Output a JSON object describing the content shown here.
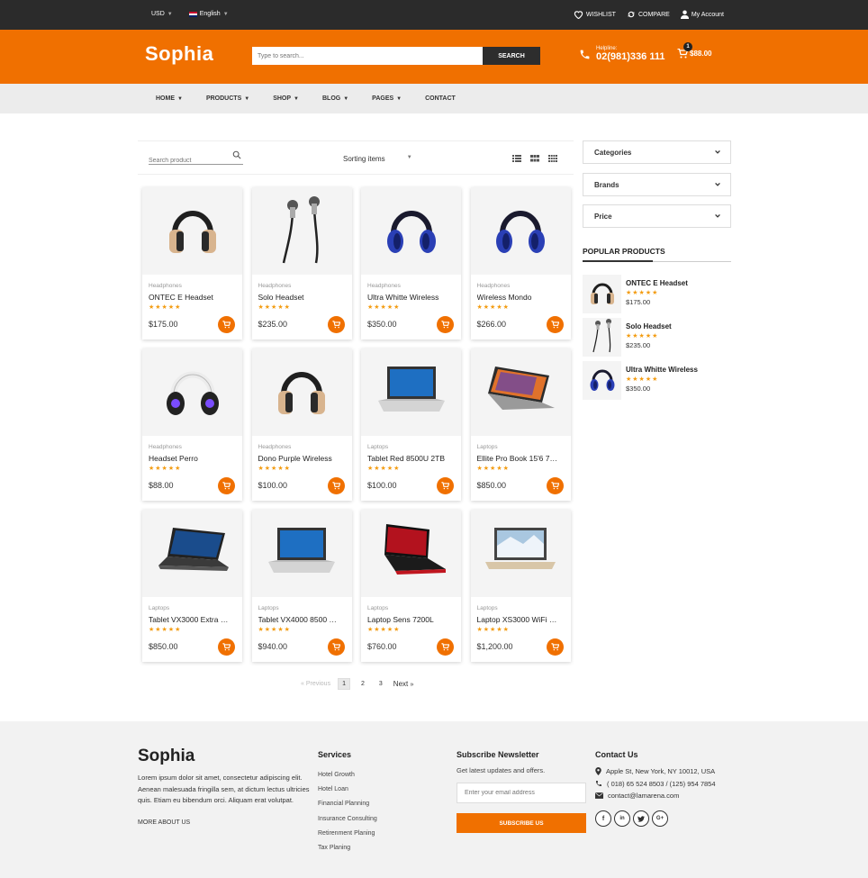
{
  "topbar": {
    "currency": "USD",
    "language": "English",
    "wishlist": "WISHLIST",
    "compare": "COMPARE",
    "account": "My Account"
  },
  "header": {
    "logo": "Sophia",
    "search_placeholder": "Type to search...",
    "search_button": "SEARCH",
    "helpline_label": "Helpline:",
    "helpline_number": "02(981)336 111",
    "cart_count": "1",
    "cart_total": "$88.00",
    "accent_color": "#f07000"
  },
  "nav": {
    "items": [
      "HOME",
      "PRODUCTS",
      "SHOP",
      "BLOG",
      "PAGES",
      "CONTACT"
    ]
  },
  "toolbar": {
    "search_placeholder": "Search product",
    "sorting": "Sorting items"
  },
  "products": [
    {
      "category": "Headphones",
      "name": "ONTEC E Headset",
      "price": "$175.00",
      "image": "headphone-beige-icon",
      "rating": 5
    },
    {
      "category": "Headphones",
      "name": "Solo Headset",
      "price": "$235.00",
      "image": "earphones-icon",
      "rating": 5
    },
    {
      "category": "Headphones",
      "name": "Ultra Whitte Wireless",
      "price": "$350.00",
      "image": "headphone-blue-icon",
      "rating": 5
    },
    {
      "category": "Headphones",
      "name": "Wireless Mondo",
      "price": "$266.00",
      "image": "headphone-blue-icon",
      "rating": 5
    },
    {
      "category": "Headphones",
      "name": "Headset Perro",
      "price": "$88.00",
      "image": "headphone-white-icon",
      "rating": 5
    },
    {
      "category": "Headphones",
      "name": "Dono Purple Wireless",
      "price": "$100.00",
      "image": "headphone-beige-icon",
      "rating": 5
    },
    {
      "category": "Laptops",
      "name": "Tablet Red 8500U 2TB",
      "price": "$100.00",
      "image": "laptop-silver-icon",
      "rating": 5
    },
    {
      "category": "Laptops",
      "name": "Ellite Pro Book 15'6 7…",
      "price": "$850.00",
      "image": "laptop-convertible-icon",
      "rating": 5
    },
    {
      "category": "Laptops",
      "name": "Tablet VX3000 Extra …",
      "price": "$850.00",
      "image": "laptop-dark-icon",
      "rating": 5
    },
    {
      "category": "Laptops",
      "name": "Tablet VX4000 8500 …",
      "price": "$940.00",
      "image": "laptop-silver-icon",
      "rating": 5
    },
    {
      "category": "Laptops",
      "name": "Laptop Sens 7200L",
      "price": "$760.00",
      "image": "laptop-gaming-icon",
      "rating": 5
    },
    {
      "category": "Laptops",
      "name": "Laptop XS3000 WiFi …",
      "price": "$1,200.00",
      "image": "laptop-gold-icon",
      "rating": 5
    }
  ],
  "pagination": {
    "previous": "Previous",
    "pages": [
      "1",
      "2",
      "3"
    ],
    "current": "1",
    "next": "Next"
  },
  "sidebar": {
    "filters": [
      "Categories",
      "Brands",
      "Price"
    ],
    "popular_title": "POPULAR PRODUCTS",
    "popular": [
      {
        "name": "ONTEC E Headset",
        "price": "$175.00",
        "image": "headphone-beige-icon"
      },
      {
        "name": "Solo Headset",
        "price": "$235.00",
        "image": "earphones-icon"
      },
      {
        "name": "Ultra Whitte Wireless",
        "price": "$350.00",
        "image": "headphone-blue-icon"
      }
    ]
  },
  "footer": {
    "logo": "Sophia",
    "about": "Lorem ipsum dolor sit amet, consectetur adipiscing elit. Aenean malesuada fringilla sem, at dictum lectus ultricies quis. Etiam eu bibendum orci. Aliquam erat volutpat.",
    "more": "MORE ABOUT US",
    "services_title": "Services",
    "services": [
      "Hotel Growth",
      "Hotel Loan",
      "Financial Planning",
      "Insurance Consulting",
      "Retirenment Planing",
      "Tax Planing"
    ],
    "newsletter_title": "Subscribe Newsletter",
    "newsletter_desc": "Get latest updates and offers.",
    "newsletter_placeholder": "Enter your email address",
    "subscribe": "SUBSCRIBE US",
    "contact_title": "Contact Us",
    "address": "Apple St, New York, NY 10012, USA",
    "phone": "( 018) 65 524 8503 / (125) 954 7854",
    "email": "contact@lamarena.com",
    "socials": [
      "f",
      "in",
      "t",
      "G+"
    ]
  }
}
